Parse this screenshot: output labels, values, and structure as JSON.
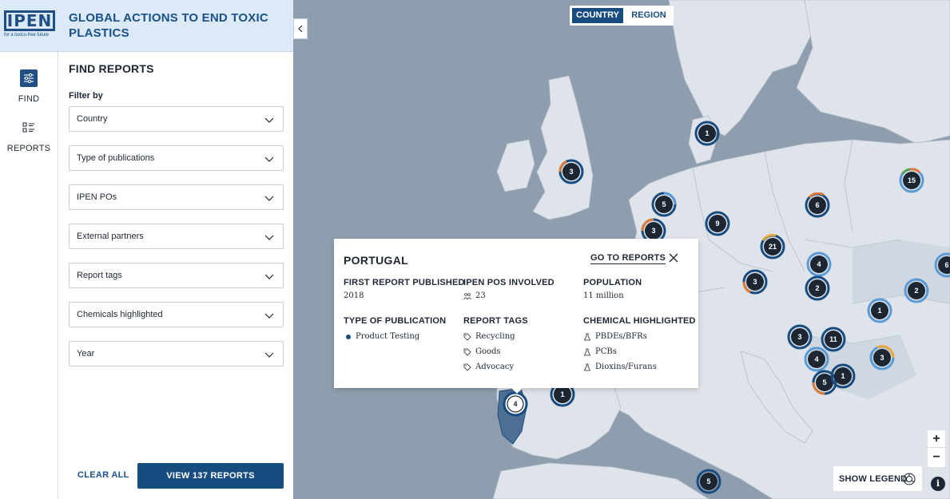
{
  "brand": {
    "logo_text": "IPEN",
    "logo_tagline": "for a toxics-free future",
    "title": "GLOBAL ACTIONS TO END TOXIC PLASTICS"
  },
  "rail": {
    "find_label": "FIND",
    "reports_label": "REPORTS"
  },
  "panel": {
    "title": "FIND REPORTS",
    "filter_by": "Filter by",
    "filters": [
      "Country",
      "Type of publications",
      "IPEN POs",
      "External partners",
      "Report tags",
      "Chemicals highlighted",
      "Year"
    ],
    "clear_all": "CLEAR ALL",
    "view_button": "VIEW 137 REPORTS"
  },
  "map": {
    "toggle": {
      "country": "COUNTRY",
      "region": "REGION",
      "selected": "COUNTRY"
    },
    "markers": [
      "1",
      "3",
      "5",
      "3",
      "9",
      "6",
      "15",
      "21",
      "4",
      "3",
      "2",
      "2",
      "1",
      "3",
      "11",
      "4",
      "3",
      "5",
      "1",
      "4",
      "1",
      "5",
      "6"
    ],
    "show_legend": "SHOW LEGEND",
    "zoom_in": "+",
    "zoom_out": "−",
    "info": "i"
  },
  "popup": {
    "country": "PORTUGAL",
    "go_to_reports": "GO TO REPORTS",
    "first_report_label": "FIRST REPORT PUBLISHED",
    "first_report_value": "2018",
    "ipen_pos_label": "IPEN POS INVOLVED",
    "ipen_pos_value": "23",
    "population_label": "POPULATION",
    "population_value": "11 million",
    "type_label": "TYPE OF PUBLICATION",
    "types": [
      "Product Testing"
    ],
    "tags_label": "REPORT TAGS",
    "tags": [
      "Recycling",
      "Goods",
      "Advocacy"
    ],
    "chemicals_label": "CHEMICAL HIGHLIGHTED",
    "chemicals": [
      "PBDEs/BFRs",
      "PCBs",
      "Dioxins/Furans"
    ]
  },
  "colors": {
    "primary": "#174c80",
    "brand_bg": "#dce9f6",
    "sea": "#8f9eae",
    "land": "#dfe4ea",
    "land_dark": "#b9c2cc",
    "ring_orange": "#e07b39",
    "ring_yellow": "#e8a93a",
    "ring_light": "#5b9bd5",
    "ring_green": "#5aa05a"
  }
}
